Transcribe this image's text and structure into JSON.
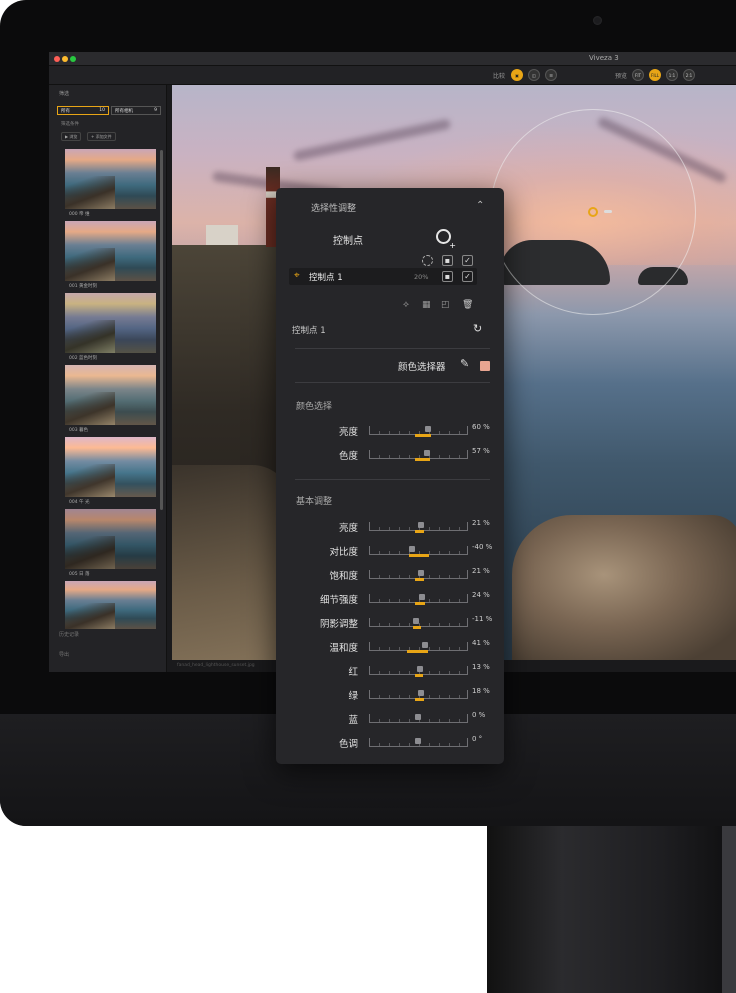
{
  "app": {
    "title": "Viveza 3",
    "toolbar": {
      "compare_label": "比较",
      "preview_label": "预览",
      "zoom_options": [
        "FIT",
        "FILL",
        "1:1",
        "2:1"
      ]
    }
  },
  "browser": {
    "header": "筛选",
    "filter_fields": [
      "所有",
      "所有相机"
    ],
    "filter_counts": [
      "10",
      "9"
    ],
    "subheader": "筛选条件",
    "buttons": [
      "▶ 浏览",
      "+ 添加文件"
    ],
    "thumbnails": [
      {
        "label": "000 帝 维"
      },
      {
        "label": "001 黄金时刻"
      },
      {
        "label": "002 蓝色时刻"
      },
      {
        "label": "003 暮色"
      },
      {
        "label": "004 午 光"
      },
      {
        "label": "005 日 落"
      },
      {
        "label": ""
      }
    ],
    "footer": [
      "历史记录",
      "导出"
    ]
  },
  "status_text": "fanad_head_lighthouse_sunset.jpg",
  "panel": {
    "title": "选择性调整",
    "control_points_label": "控制点",
    "control_point_row": {
      "name": "控制点 1",
      "percent": "20%"
    },
    "selected_cp_label": "控制点 1",
    "color_picker_label": "颜色选择器",
    "picker_color": "#e8a591",
    "accent_color": "#e8a516",
    "color_selection": {
      "title": "颜色选择",
      "sliders": [
        {
          "label": "亮度",
          "value": "60 %",
          "level": 60,
          "fill": 0
        },
        {
          "label": "色度",
          "value": "57 %",
          "level": 57,
          "fill": 0
        }
      ]
    },
    "basic": {
      "title": "基本调整",
      "sliders": [
        {
          "label": "亮度",
          "value": "21 %",
          "level": 21,
          "fill": 0
        },
        {
          "label": "对比度",
          "value": "-40 %",
          "level": -40,
          "fill": 1
        },
        {
          "label": "饱和度",
          "value": "21 %",
          "level": 21,
          "fill": 0
        },
        {
          "label": "细节强度",
          "value": "24 %",
          "level": 24,
          "fill": 0
        },
        {
          "label": "阴影调整",
          "value": "-11 %",
          "level": -11,
          "fill": 0
        },
        {
          "label": "温和度",
          "value": "41 %",
          "level": 41,
          "fill": 1
        },
        {
          "label": "红",
          "value": "13 %",
          "level": 13,
          "fill": 0
        },
        {
          "label": "绿",
          "value": "18 %",
          "level": 18,
          "fill": 0
        },
        {
          "label": "蓝",
          "value": "0 %",
          "level": 0,
          "fill": 0
        },
        {
          "label": "色调",
          "value": "0 °",
          "level": 0,
          "fill": 0
        }
      ]
    }
  }
}
